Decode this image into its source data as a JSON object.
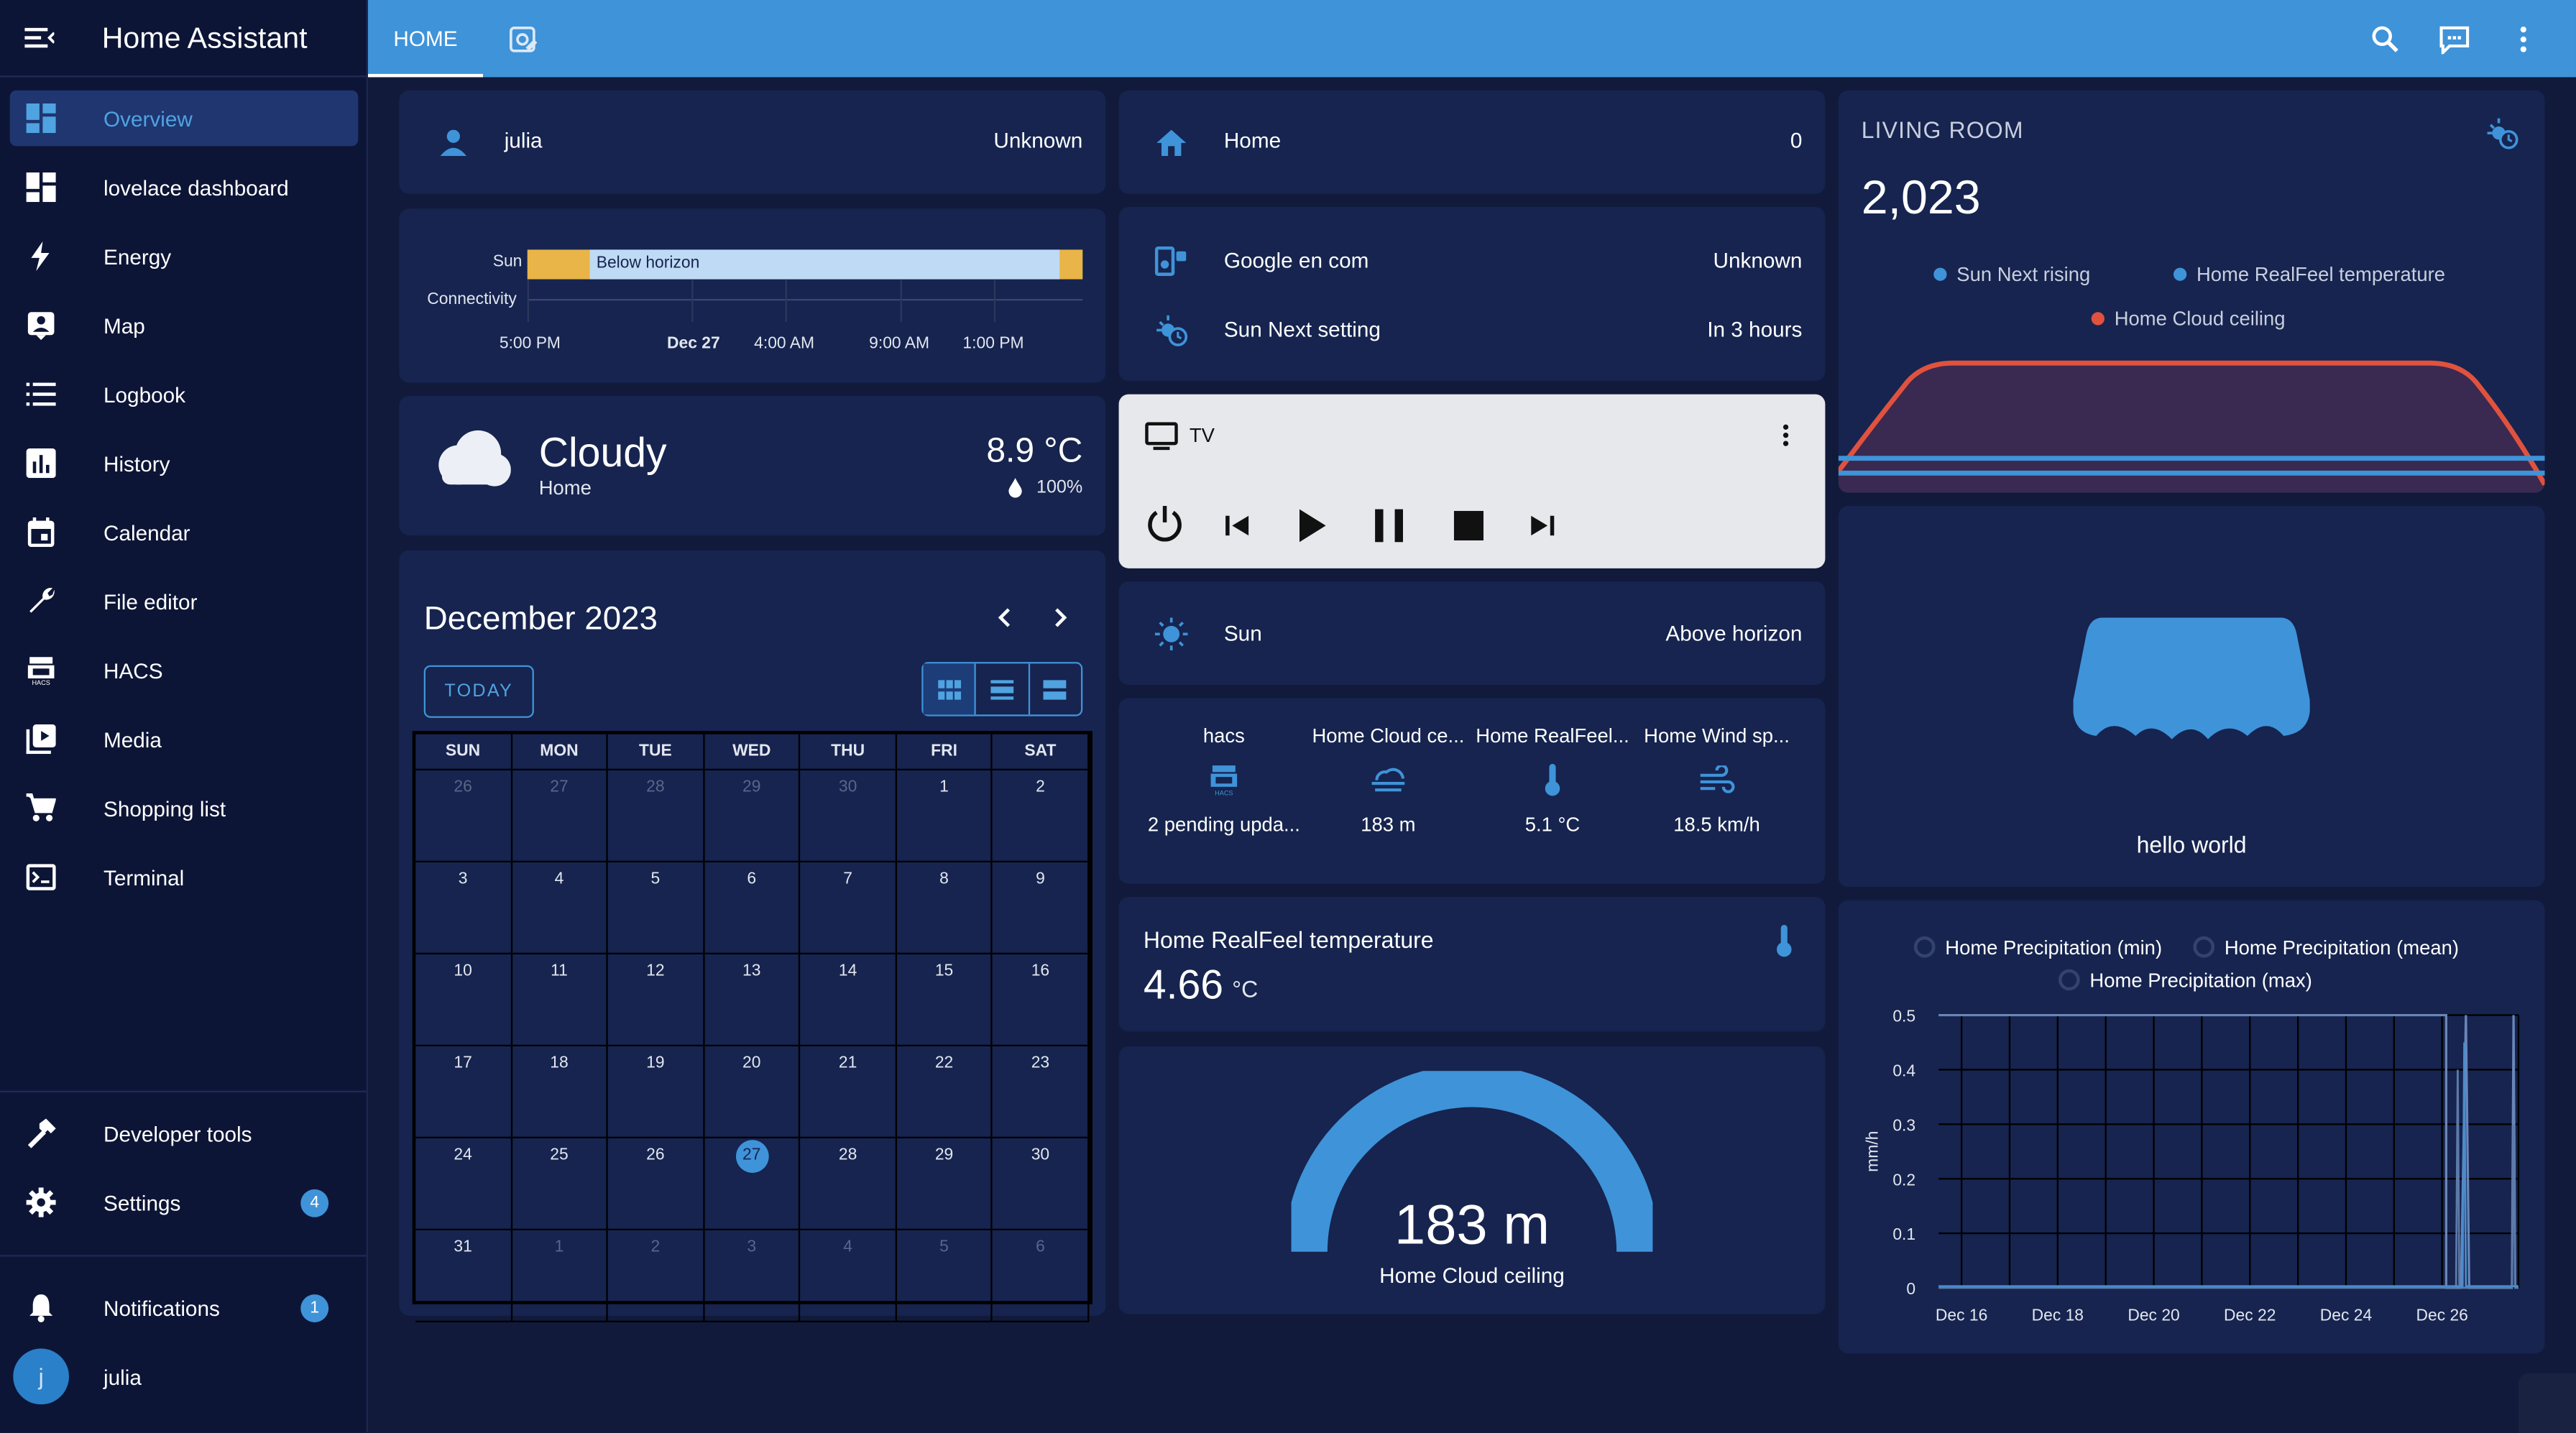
{
  "sidebar": {
    "title": "Home Assistant",
    "items": [
      {
        "label": "Overview",
        "icon": "view-dashboard-icon"
      },
      {
        "label": "lovelace dashboard",
        "icon": "view-dashboard-icon"
      },
      {
        "label": "Energy",
        "icon": "lightning-bolt-icon"
      },
      {
        "label": "Map",
        "icon": "account-box-icon"
      },
      {
        "label": "Logbook",
        "icon": "format-list-icon"
      },
      {
        "label": "History",
        "icon": "chart-box-icon"
      },
      {
        "label": "Calendar",
        "icon": "calendar-icon"
      },
      {
        "label": "File editor",
        "icon": "wrench-icon"
      },
      {
        "label": "HACS",
        "icon": "hacs-icon"
      },
      {
        "label": "Media",
        "icon": "play-box-icon"
      },
      {
        "label": "Shopping list",
        "icon": "cart-icon"
      },
      {
        "label": "Terminal",
        "icon": "console-icon"
      }
    ],
    "developer_tools": "Developer tools",
    "settings": "Settings",
    "settings_badge": "4",
    "notifications": "Notifications",
    "notifications_badge": "1",
    "user_name": "julia",
    "user_initial": "j"
  },
  "topbar": {
    "tab_home": "HOME"
  },
  "person": {
    "name": "julia",
    "state": "Unknown"
  },
  "history": {
    "row_sun": "Sun",
    "row_conn": "Connectivity",
    "bar_label": "Below horizon",
    "ticks": [
      "5:00 PM",
      "Dec 27",
      "4:00 AM",
      "9:00 AM",
      "1:00 PM"
    ]
  },
  "weather": {
    "condition": "Cloudy",
    "location": "Home",
    "temperature": "8.9 °C",
    "humidity": "100%"
  },
  "calendar": {
    "title": "December 2023",
    "today_button": "TODAY",
    "weekdays": [
      "SUN",
      "MON",
      "TUE",
      "WED",
      "THU",
      "FRI",
      "SAT"
    ],
    "weeks": [
      [
        "26",
        "27",
        "28",
        "29",
        "30",
        "1",
        "2"
      ],
      [
        "3",
        "4",
        "5",
        "6",
        "7",
        "8",
        "9"
      ],
      [
        "10",
        "11",
        "12",
        "13",
        "14",
        "15",
        "16"
      ],
      [
        "17",
        "18",
        "19",
        "20",
        "21",
        "22",
        "23"
      ],
      [
        "24",
        "25",
        "26",
        "27",
        "28",
        "29",
        "30"
      ],
      [
        "31",
        "1",
        "2",
        "3",
        "4",
        "5",
        "6"
      ]
    ],
    "today": "27"
  },
  "home_zone": {
    "name": "Home",
    "state": "0"
  },
  "google": {
    "name": "Google en com",
    "state": "Unknown"
  },
  "sun_setting": {
    "name": "Sun Next setting",
    "state": "In 3 hours"
  },
  "media": {
    "name": "TV"
  },
  "sun": {
    "name": "Sun",
    "state": "Above horizon"
  },
  "glance": [
    {
      "name": "hacs",
      "icon": "hacs-icon",
      "state": "2 pending upda..."
    },
    {
      "name": "Home Cloud ce...",
      "icon": "weather-fog-icon",
      "state": "183 m"
    },
    {
      "name": "Home RealFeel...",
      "icon": "thermometer-icon",
      "state": "5.1 °C"
    },
    {
      "name": "Home Wind sp...",
      "icon": "weather-windy-icon",
      "state": "18.5 km/h"
    }
  ],
  "realfeel": {
    "name": "Home RealFeel temperature",
    "value": "4.66",
    "unit": "°C"
  },
  "gauge": {
    "value": "183 m",
    "name": "Home Cloud ceiling",
    "fraction": 1.0
  },
  "living_room": {
    "title": "LIVING ROOM",
    "value": "2,023",
    "legend": [
      {
        "name": "Sun Next rising",
        "color": "#3f93d9"
      },
      {
        "name": "Home RealFeel temperature",
        "color": "#3f93d9"
      },
      {
        "name": "Home Cloud ceiling",
        "color": "#e0523e"
      }
    ]
  },
  "hello": {
    "text": "hello world"
  },
  "chart_data": {
    "type": "line",
    "series": [
      {
        "name": "Home Precipitation (min)",
        "values": [
          0,
          0,
          0,
          0,
          0,
          0,
          0.5
        ]
      },
      {
        "name": "Home Precipitation (mean)",
        "values": [
          0,
          0,
          0,
          0,
          0,
          0,
          0.5
        ]
      },
      {
        "name": "Home Precipitation (max)",
        "values": [
          0.5,
          0.5,
          0.5,
          0.5,
          0.5,
          0.5,
          0
        ]
      }
    ],
    "x": [
      "Dec 16",
      "Dec 18",
      "Dec 20",
      "Dec 22",
      "Dec 24",
      "Dec 26"
    ],
    "ylabel": "mm/h",
    "yticks": [
      "0.5",
      "0.4",
      "0.3",
      "0.2",
      "0.1",
      "0"
    ],
    "ylim": [
      0,
      0.5
    ]
  }
}
